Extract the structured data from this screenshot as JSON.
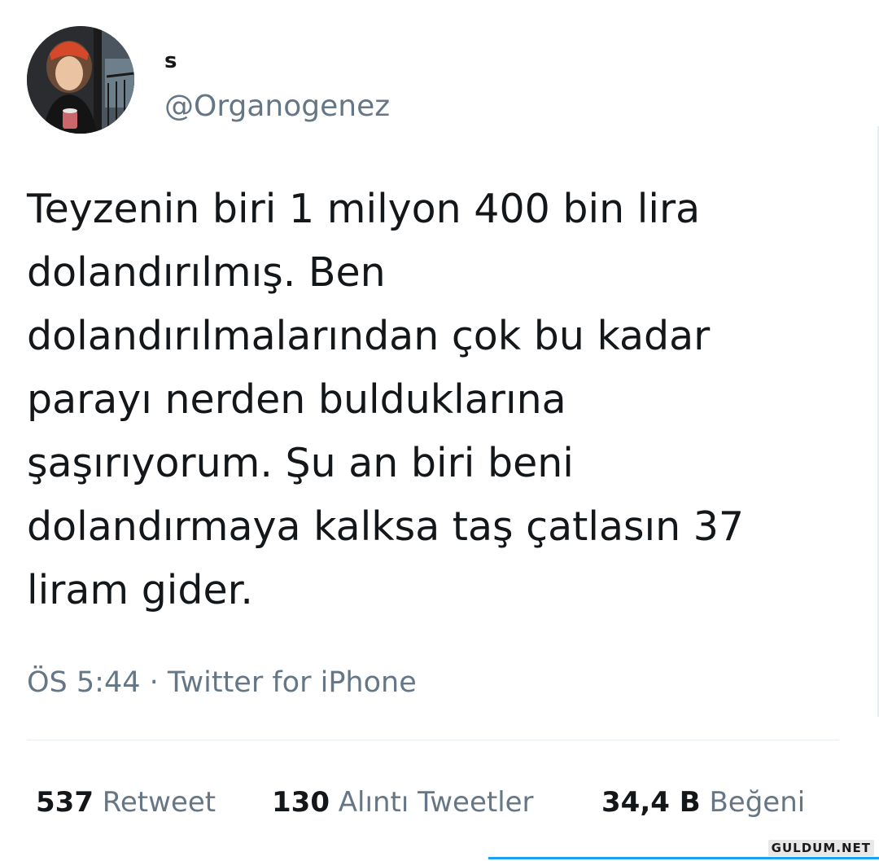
{
  "tweet": {
    "display_name": "s",
    "handle": "@Organogenez",
    "avatar_icon": "profile-photo",
    "text_lines": [
      "Teyzenin biri 1 milyon 400 bin lira",
      "dolandırılmış. Ben",
      "dolandırılmalarından çok bu kadar",
      "parayı nerden bulduklarına",
      "şaşırıyorum. Şu an biri beni",
      "dolandırmaya kalksa taş çatlasın 37",
      "liram gider."
    ],
    "time": "ÖS 5:44",
    "separator": "·",
    "source": "Twitter for iPhone"
  },
  "stats": {
    "retweets": {
      "count": "537",
      "label": "Retweet"
    },
    "quotes": {
      "count": "130",
      "label": "Alıntı Tweetler"
    },
    "likes": {
      "count": "34,4 B",
      "label": "Beğeni"
    }
  },
  "watermark": "GULDUM.NET",
  "colors": {
    "text": "#14171a",
    "secondary": "#657786",
    "divider": "#e6ecf0",
    "accent": "#1da1f2"
  }
}
